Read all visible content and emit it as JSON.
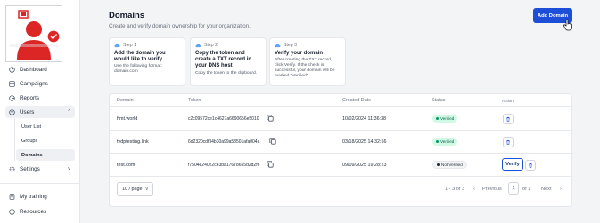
{
  "sidebar": {
    "items": [
      {
        "label": "Dashboard",
        "icon": "dashboard-icon"
      },
      {
        "label": "Campaigns",
        "icon": "campaigns-icon"
      },
      {
        "label": "Reports",
        "icon": "reports-icon"
      },
      {
        "label": "Users",
        "icon": "users-icon"
      },
      {
        "label": "Settings",
        "icon": "settings-icon"
      },
      {
        "label": "My training",
        "icon": "training-icon"
      },
      {
        "label": "Resources",
        "icon": "resources-icon"
      }
    ],
    "users_sub": [
      "User List",
      "Groups",
      "Domains"
    ],
    "chevron_up": "^",
    "chevron_down": "v"
  },
  "header": {
    "title": "Domains",
    "subtitle": "Create and verify domain ownership for your organization.",
    "add_button": "Add Domain"
  },
  "steps": [
    {
      "label": "Step 1",
      "title": "Add the domain you would like to verify",
      "desc": "Use the following format: domain.com"
    },
    {
      "label": "Step 2",
      "title": "Copy the token and create a TXT record in your DNS host",
      "desc": "Copy the token to the clipboard."
    },
    {
      "label": "Step 3",
      "title": "Verify your domain",
      "desc": "After creating the TXT record, click Verify. If the check is successful, your domain will be marked \"Verified\"."
    }
  ],
  "table": {
    "headers": [
      "Domain",
      "Token",
      "Created Date",
      "Status",
      "Action"
    ],
    "rows": [
      {
        "domain": "ftmt.world",
        "token": "c2c09572ce1c4627a6690656e5010",
        "created": "10/02/2024 11:36:38",
        "status": "Verified"
      },
      {
        "domain": "tvdptesting.link",
        "token": "6d2320cdf34b30a99a58501afa004a",
        "created": "03/18/2025 14:32:56",
        "status": "Verified"
      },
      {
        "domain": "test.com",
        "token": "f7504e24022ce3ba17678655d2d2f6",
        "created": "09/09/2025 19:28:23",
        "status": "Not Verified",
        "verify_label": "Verify"
      }
    ]
  },
  "pagination": {
    "per_page": "10 / page",
    "range": "1 - 3 of 3",
    "previous": "Previous",
    "page": "1",
    "of": "of 1",
    "next": "Next"
  },
  "colors": {
    "primary": "#1d4ed8",
    "verified_bg": "#d1fae5",
    "verified_text": "#065f46",
    "logo_red": "#dc2626"
  }
}
